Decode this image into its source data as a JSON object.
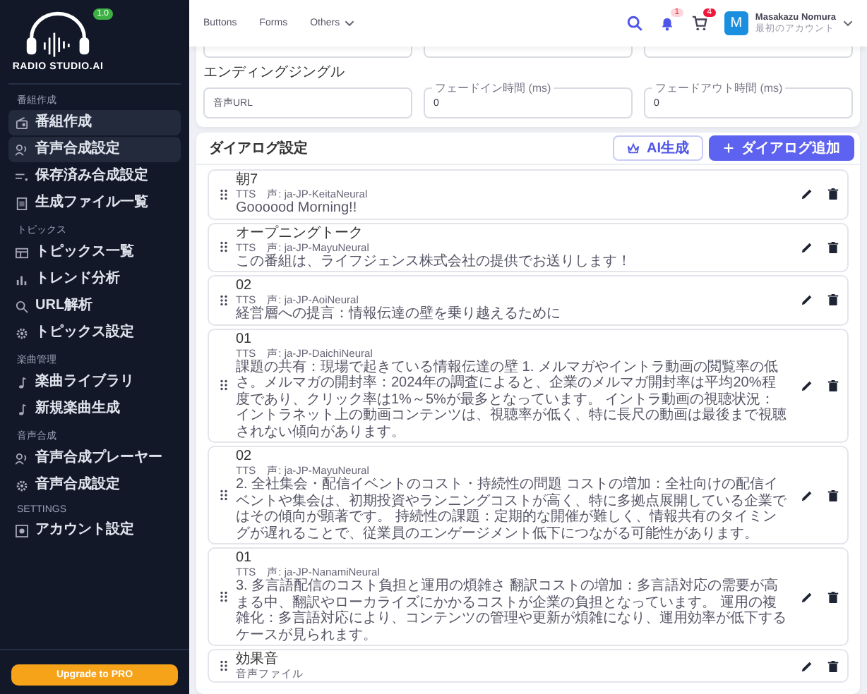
{
  "sidebar": {
    "logo_text": "RADIO STUDIO.AI",
    "version_badge": "1.0",
    "sections": [
      {
        "title": "番組作成",
        "items": [
          {
            "label": "番組作成",
            "selected": true
          },
          {
            "label": "音声合成設定",
            "selected": true
          },
          {
            "label": "保存済み合成設定",
            "selected": false
          },
          {
            "label": "生成ファイル一覧",
            "selected": false
          }
        ]
      },
      {
        "title": "トピックス",
        "items": [
          {
            "label": "トピックス一覧",
            "selected": false
          },
          {
            "label": "トレンド分析",
            "selected": false
          },
          {
            "label": "URL解析",
            "selected": false
          },
          {
            "label": "トピックス設定",
            "selected": false
          }
        ]
      },
      {
        "title": "楽曲管理",
        "items": [
          {
            "label": "楽曲ライブラリ",
            "selected": false
          },
          {
            "label": "新規楽曲生成",
            "selected": false
          }
        ]
      },
      {
        "title": "音声合成",
        "items": [
          {
            "label": "音声合成プレーヤー",
            "selected": false
          },
          {
            "label": "音声合成設定",
            "selected": false
          }
        ]
      },
      {
        "title": "SETTINGS",
        "items": [
          {
            "label": "アカウント設定",
            "selected": false
          }
        ]
      }
    ],
    "upgrade_button": "Upgrade to PRO"
  },
  "header": {
    "nav": [
      {
        "label": "Buttons",
        "dropdown": false
      },
      {
        "label": "Forms",
        "dropdown": false
      },
      {
        "label": "Others",
        "dropdown": true
      }
    ],
    "notification_badge": "1",
    "cart_badge": "4",
    "avatar_letter": "M",
    "user_name": "Masakazu Nomura",
    "user_subtitle": "最初のアカウント"
  },
  "ending_jingle": {
    "label": "エンディングジングル",
    "url_placeholder": "音声URL",
    "fade_in_label": "フェードイン時間 (ms)",
    "fade_in_value": "0",
    "fade_out_label": "フェードアウト時間 (ms)",
    "fade_out_value": "0"
  },
  "dialog_settings": {
    "title": "ダイアログ設定",
    "ai_button": "AI生成",
    "add_button": "ダイアログ追加",
    "items": [
      {
        "title": "朝7",
        "type": "TTS",
        "voice": "声: ja-JP-KeitaNeural",
        "text": "Goooood Morning!!"
      },
      {
        "title": "オープニングトーク",
        "type": "TTS",
        "voice": "声: ja-JP-MayuNeural",
        "text": "この番組は、ライフジェンス株式会社の提供でお送りします！"
      },
      {
        "title": "02",
        "type": "TTS",
        "voice": "声: ja-JP-AoiNeural",
        "text": "経営層への提言：情報伝達の壁を乗り越えるために"
      },
      {
        "title": "01",
        "type": "TTS",
        "voice": "声: ja-JP-DaichiNeural",
        "text": "課題の共有：現場で起きている情報伝達の壁 1. メルマガやイントラ動画の閲覧率の低さ。メルマガの開封率：2024年の調査によると、企業のメルマガ開封率は平均20%程度であり、クリック率は1%～5%が最多となっています。 イントラ動画の視聴状況：イントラネット上の動画コンテンツは、視聴率が低く、特に長尺の動画は最後まで視聴されない傾向があります。"
      },
      {
        "title": "02",
        "type": "TTS",
        "voice": "声: ja-JP-MayuNeural",
        "text": "2. 全社集会・配信イベントのコスト・持続性の問題 コストの増加：全社向けの配信イベントや集会は、初期投資やランニングコストが高く、特に多拠点展開している企業ではその傾向が顕著です。 持続性の課題：定期的な開催が難しく、情報共有のタイミングが遅れることで、従業員のエンゲージメント低下につながる可能性があります。"
      },
      {
        "title": "01",
        "type": "TTS",
        "voice": "声: ja-JP-NanamiNeural",
        "text": "3. 多言語配信のコスト負担と運用の煩雑さ 翻訳コストの増加：多言語対応の需要が高まる中、翻訳やローカライズにかかるコストが企業の負担となっています。 運用の複雑化：多言語対応により、コンテンツの管理や更新が煩雑になり、運用効率が低下するケースが見られます。"
      },
      {
        "title": "効果音",
        "type": "音声ファイル"
      }
    ]
  }
}
